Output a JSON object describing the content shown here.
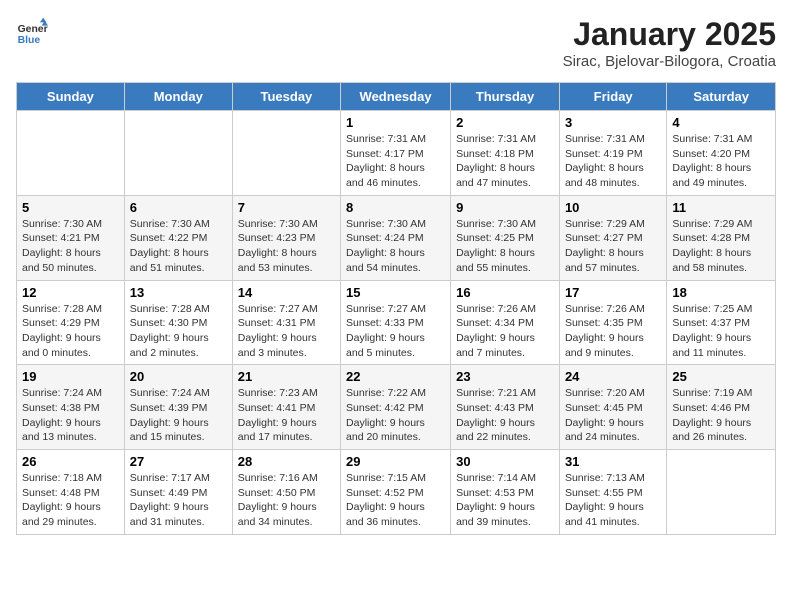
{
  "header": {
    "logo_general": "General",
    "logo_blue": "Blue",
    "month": "January 2025",
    "location": "Sirac, Bjelovar-Bilogora, Croatia"
  },
  "days_of_week": [
    "Sunday",
    "Monday",
    "Tuesday",
    "Wednesday",
    "Thursday",
    "Friday",
    "Saturday"
  ],
  "weeks": [
    [
      {
        "day": "",
        "info": ""
      },
      {
        "day": "",
        "info": ""
      },
      {
        "day": "",
        "info": ""
      },
      {
        "day": "1",
        "info": "Sunrise: 7:31 AM\nSunset: 4:17 PM\nDaylight: 8 hours and 46 minutes."
      },
      {
        "day": "2",
        "info": "Sunrise: 7:31 AM\nSunset: 4:18 PM\nDaylight: 8 hours and 47 minutes."
      },
      {
        "day": "3",
        "info": "Sunrise: 7:31 AM\nSunset: 4:19 PM\nDaylight: 8 hours and 48 minutes."
      },
      {
        "day": "4",
        "info": "Sunrise: 7:31 AM\nSunset: 4:20 PM\nDaylight: 8 hours and 49 minutes."
      }
    ],
    [
      {
        "day": "5",
        "info": "Sunrise: 7:30 AM\nSunset: 4:21 PM\nDaylight: 8 hours and 50 minutes."
      },
      {
        "day": "6",
        "info": "Sunrise: 7:30 AM\nSunset: 4:22 PM\nDaylight: 8 hours and 51 minutes."
      },
      {
        "day": "7",
        "info": "Sunrise: 7:30 AM\nSunset: 4:23 PM\nDaylight: 8 hours and 53 minutes."
      },
      {
        "day": "8",
        "info": "Sunrise: 7:30 AM\nSunset: 4:24 PM\nDaylight: 8 hours and 54 minutes."
      },
      {
        "day": "9",
        "info": "Sunrise: 7:30 AM\nSunset: 4:25 PM\nDaylight: 8 hours and 55 minutes."
      },
      {
        "day": "10",
        "info": "Sunrise: 7:29 AM\nSunset: 4:27 PM\nDaylight: 8 hours and 57 minutes."
      },
      {
        "day": "11",
        "info": "Sunrise: 7:29 AM\nSunset: 4:28 PM\nDaylight: 8 hours and 58 minutes."
      }
    ],
    [
      {
        "day": "12",
        "info": "Sunrise: 7:28 AM\nSunset: 4:29 PM\nDaylight: 9 hours and 0 minutes."
      },
      {
        "day": "13",
        "info": "Sunrise: 7:28 AM\nSunset: 4:30 PM\nDaylight: 9 hours and 2 minutes."
      },
      {
        "day": "14",
        "info": "Sunrise: 7:27 AM\nSunset: 4:31 PM\nDaylight: 9 hours and 3 minutes."
      },
      {
        "day": "15",
        "info": "Sunrise: 7:27 AM\nSunset: 4:33 PM\nDaylight: 9 hours and 5 minutes."
      },
      {
        "day": "16",
        "info": "Sunrise: 7:26 AM\nSunset: 4:34 PM\nDaylight: 9 hours and 7 minutes."
      },
      {
        "day": "17",
        "info": "Sunrise: 7:26 AM\nSunset: 4:35 PM\nDaylight: 9 hours and 9 minutes."
      },
      {
        "day": "18",
        "info": "Sunrise: 7:25 AM\nSunset: 4:37 PM\nDaylight: 9 hours and 11 minutes."
      }
    ],
    [
      {
        "day": "19",
        "info": "Sunrise: 7:24 AM\nSunset: 4:38 PM\nDaylight: 9 hours and 13 minutes."
      },
      {
        "day": "20",
        "info": "Sunrise: 7:24 AM\nSunset: 4:39 PM\nDaylight: 9 hours and 15 minutes."
      },
      {
        "day": "21",
        "info": "Sunrise: 7:23 AM\nSunset: 4:41 PM\nDaylight: 9 hours and 17 minutes."
      },
      {
        "day": "22",
        "info": "Sunrise: 7:22 AM\nSunset: 4:42 PM\nDaylight: 9 hours and 20 minutes."
      },
      {
        "day": "23",
        "info": "Sunrise: 7:21 AM\nSunset: 4:43 PM\nDaylight: 9 hours and 22 minutes."
      },
      {
        "day": "24",
        "info": "Sunrise: 7:20 AM\nSunset: 4:45 PM\nDaylight: 9 hours and 24 minutes."
      },
      {
        "day": "25",
        "info": "Sunrise: 7:19 AM\nSunset: 4:46 PM\nDaylight: 9 hours and 26 minutes."
      }
    ],
    [
      {
        "day": "26",
        "info": "Sunrise: 7:18 AM\nSunset: 4:48 PM\nDaylight: 9 hours and 29 minutes."
      },
      {
        "day": "27",
        "info": "Sunrise: 7:17 AM\nSunset: 4:49 PM\nDaylight: 9 hours and 31 minutes."
      },
      {
        "day": "28",
        "info": "Sunrise: 7:16 AM\nSunset: 4:50 PM\nDaylight: 9 hours and 34 minutes."
      },
      {
        "day": "29",
        "info": "Sunrise: 7:15 AM\nSunset: 4:52 PM\nDaylight: 9 hours and 36 minutes."
      },
      {
        "day": "30",
        "info": "Sunrise: 7:14 AM\nSunset: 4:53 PM\nDaylight: 9 hours and 39 minutes."
      },
      {
        "day": "31",
        "info": "Sunrise: 7:13 AM\nSunset: 4:55 PM\nDaylight: 9 hours and 41 minutes."
      },
      {
        "day": "",
        "info": ""
      }
    ]
  ]
}
